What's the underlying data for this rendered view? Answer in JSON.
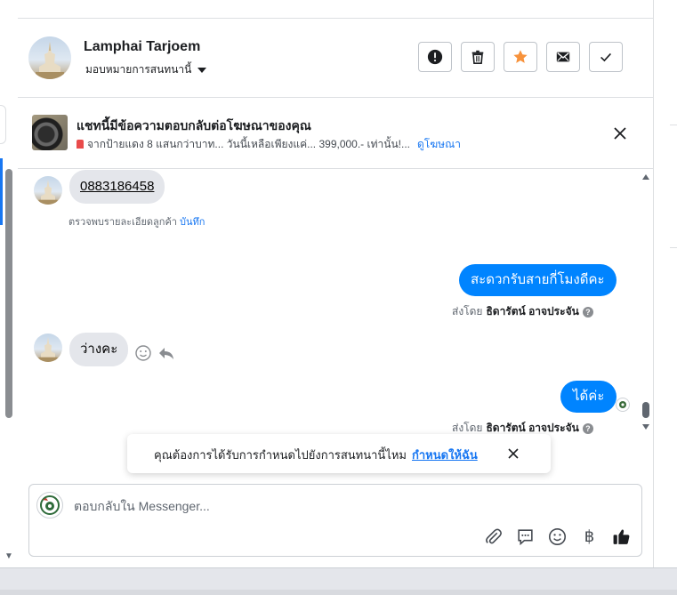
{
  "header": {
    "contact_name": "Lamphai Tarjoem",
    "assign_label": "มอบหมายการสนทนานี้",
    "buttons": [
      {
        "name": "report-button",
        "icon": "exclamation-icon"
      },
      {
        "name": "delete-button",
        "icon": "trash-icon"
      },
      {
        "name": "star-button",
        "icon": "star-icon",
        "color": "#f7923b"
      },
      {
        "name": "mark-unread-button",
        "icon": "envelope-icon"
      },
      {
        "name": "mark-done-button",
        "icon": "check-icon"
      }
    ]
  },
  "ad": {
    "title": "แชทนี้มีข้อความตอบกลับต่อโฆษณาของคุณ",
    "description": "จากป้ายแดง 8 แสนกว่าบาท... วันนี้เหลือเพียงแค่... 399,000.- เท่านั้น!...",
    "link": "ดูโฆษณา"
  },
  "messages": [
    {
      "direction": "incoming",
      "text": "0883186458",
      "note": "ตรวจพบรายละเอียดลูกค้า",
      "note_link": "บันทึก"
    },
    {
      "direction": "outgoing",
      "text": "สะดวกรับสายกี่โมงดีคะ",
      "sent_by_label": "ส่งโดย",
      "sender": "ธิดารัตน์ อาจประจัน"
    },
    {
      "direction": "incoming",
      "text": "ว่างคะ"
    },
    {
      "direction": "outgoing",
      "text": "ได้ค่ะ",
      "sent_by_label": "ส่งโดย",
      "sender": "ธิดารัตน์ อาจประจัน"
    }
  ],
  "toast": {
    "text": "คุณต้องการได้รับการกำหนดไปยังการสนทนานี้ไหม",
    "link": "กำหนดให้ฉัน"
  },
  "composer": {
    "placeholder": "ตอบกลับใน Messenger...",
    "tools": [
      "attach-icon",
      "saved-reply-icon",
      "emoji-icon",
      "baht-icon",
      "like-icon"
    ]
  },
  "colors": {
    "accent": "#1877f2",
    "outgoing_bubble": "#0084ff",
    "incoming_bubble": "#e4e6eb",
    "star": "#f7923b"
  }
}
